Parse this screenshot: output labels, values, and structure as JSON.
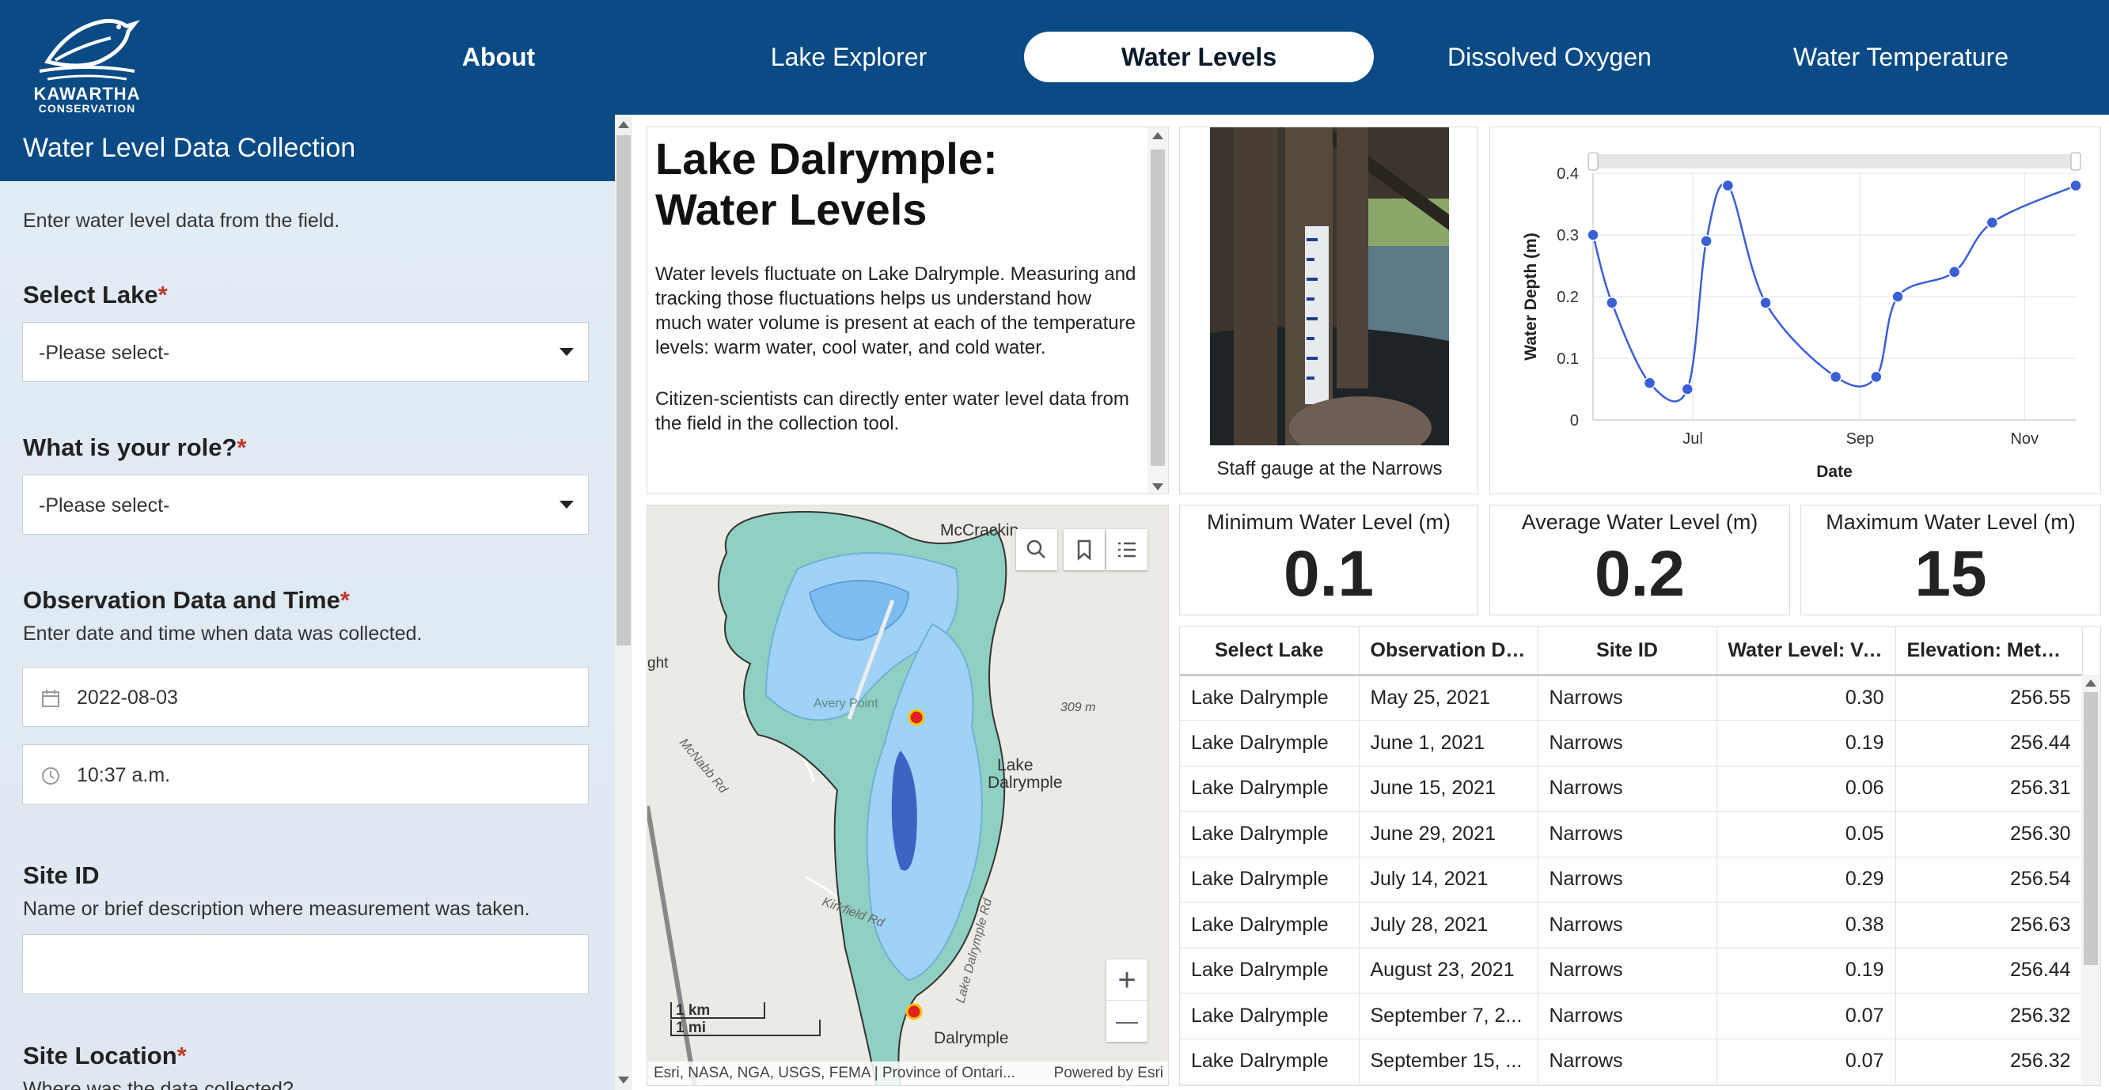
{
  "brand": {
    "line1": "KAWARTHA",
    "line2": "CONSERVATION"
  },
  "nav": {
    "items": [
      {
        "label": "About"
      },
      {
        "label": "Lake Explorer"
      },
      {
        "label": "Water Levels"
      },
      {
        "label": "Dissolved Oxygen"
      },
      {
        "label": "Water Temperature"
      }
    ],
    "active": "Water Levels"
  },
  "form": {
    "header": "Water Level Data Collection",
    "intro": "Enter water level data from the field.",
    "lake": {
      "label": "Select Lake",
      "value": "-Please select-"
    },
    "role": {
      "label": "What is your role?",
      "value": "-Please select-"
    },
    "observation": {
      "label": "Observation Data and Time",
      "hint": "Enter date and time when data was collected.",
      "date": "2022-08-03",
      "time": "10:37 a.m."
    },
    "site_id": {
      "label": "Site ID",
      "hint": "Name or brief description where measurement was taken.",
      "value": ""
    },
    "site_location": {
      "label": "Site Location",
      "hint": "Where was the data collected?"
    }
  },
  "info": {
    "title": "Lake Dalrymple: Water Levels",
    "p1": "Water levels fluctuate on Lake Dalrymple. Measuring and tracking those fluctuations helps us understand how much water volume is present at each of the temperature levels: warm water, cool water, and cold water.",
    "p2": "Citizen-scientists can directly enter water level data from the field in the collection tool."
  },
  "photo": {
    "caption": "Staff gauge at the Narrows"
  },
  "map": {
    "labels": {
      "mccracken": "McCrackin",
      "lake": "Lake",
      "dalrymple_label": "Dalrymple",
      "town": "Dalrymple",
      "elev": "309 m",
      "mcnabb": "McNabb Rd",
      "kirkfield": "Kirkfield Rd",
      "lakedal_rd": "Lake Dalrymple Rd",
      "avery": "Avery Point",
      "ght": "ght"
    },
    "scale_km": "1 km",
    "scale_mi": "1 mi",
    "attribution": "Esri, NASA, NGA, USGS, FEMA | Province of Ontari...",
    "powered": "Powered by Esri",
    "zoom_in": "+",
    "zoom_out": "—"
  },
  "stats": {
    "min": {
      "label": "Minimum Water Level (m)",
      "value": "0.1"
    },
    "avg": {
      "label": "Average Water Level (m)",
      "value": "0.2"
    },
    "max": {
      "label": "Maximum Water Level (m)",
      "value": "15"
    }
  },
  "table": {
    "columns": [
      "Select Lake",
      "Observation Da...",
      "Site ID",
      "Water Level: Va...",
      "Elevation: Meter..."
    ],
    "rows": [
      [
        "Lake Dalrymple",
        "May 25, 2021",
        "Narrows",
        "0.30",
        "256.55"
      ],
      [
        "Lake Dalrymple",
        "June 1, 2021",
        "Narrows",
        "0.19",
        "256.44"
      ],
      [
        "Lake Dalrymple",
        "June 15, 2021",
        "Narrows",
        "0.06",
        "256.31"
      ],
      [
        "Lake Dalrymple",
        "June 29, 2021",
        "Narrows",
        "0.05",
        "256.30"
      ],
      [
        "Lake Dalrymple",
        "July 14, 2021",
        "Narrows",
        "0.29",
        "256.54"
      ],
      [
        "Lake Dalrymple",
        "July 28, 2021",
        "Narrows",
        "0.38",
        "256.63"
      ],
      [
        "Lake Dalrymple",
        "August 23, 2021",
        "Narrows",
        "0.19",
        "256.44"
      ],
      [
        "Lake Dalrymple",
        "September 7, 2...",
        "Narrows",
        "0.07",
        "256.32"
      ],
      [
        "Lake Dalrymple",
        "September 15, ...",
        "Narrows",
        "0.07",
        "256.32"
      ]
    ]
  },
  "colors": {
    "brand_blue": "#0a4a85",
    "series": "#3a5fd6",
    "map_water": "#9fd2f5",
    "map_shore": "#8fd0c2"
  },
  "chart_data": {
    "type": "line",
    "xlabel": "Date",
    "ylabel": "Water Depth (m)",
    "ylim": [
      0,
      0.4
    ],
    "yticks": [
      "0",
      "0.1",
      "0.2",
      "0.3",
      "0.4"
    ],
    "xticks": [
      "Jul",
      "Sep",
      "Nov"
    ],
    "xtick_dates": [
      "2021-07-01",
      "2021-09-01",
      "2021-11-01"
    ],
    "xlim": [
      "2021-05-25",
      "2021-11-20"
    ],
    "grid": true,
    "series": [
      {
        "x": [
          "2021-05-25",
          "2021-06-01",
          "2021-06-15",
          "2021-06-29",
          "2021-07-06",
          "2021-07-14",
          "2021-07-28",
          "2021-08-23",
          "2021-09-07",
          "2021-09-15",
          "2021-10-06",
          "2021-10-20",
          "2021-11-20"
        ],
        "y": [
          0.3,
          0.19,
          0.06,
          0.05,
          0.29,
          0.38,
          0.19,
          0.07,
          0.07,
          0.2,
          0.24,
          0.32,
          0.38
        ]
      }
    ]
  }
}
